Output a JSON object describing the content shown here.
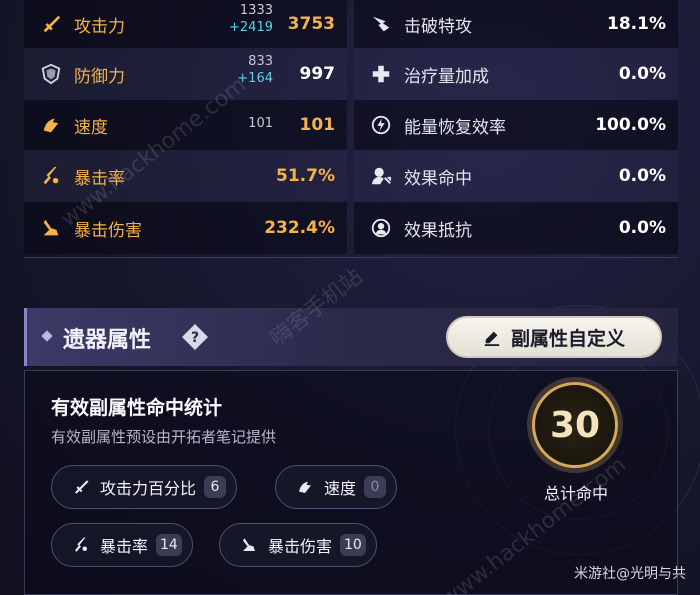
{
  "stats_left": [
    {
      "label": "攻击力",
      "icon": "attack-icon",
      "base": "1333",
      "bonus": "+2419",
      "value": "3753",
      "value_color": "gold"
    },
    {
      "label": "防御力",
      "icon": "defense-icon",
      "base": "833",
      "bonus": "+164",
      "value": "997",
      "value_color": "white"
    },
    {
      "label": "速度",
      "icon": "speed-icon",
      "base": "101",
      "bonus": "",
      "value": "101",
      "value_color": "gold"
    },
    {
      "label": "暴击率",
      "icon": "crit-rate-icon",
      "base": "",
      "bonus": "",
      "value": "51.7%",
      "value_color": "gold"
    },
    {
      "label": "暴击伤害",
      "icon": "crit-damage-icon",
      "base": "",
      "bonus": "",
      "value": "232.4%",
      "value_color": "gold"
    }
  ],
  "stats_right": [
    {
      "label": "击破特攻",
      "icon": "break-effect-icon",
      "value": "18.1%"
    },
    {
      "label": "治疗量加成",
      "icon": "healing-boost-icon",
      "value": "0.0%"
    },
    {
      "label": "能量恢复效率",
      "icon": "energy-regen-icon",
      "value": "100.0%"
    },
    {
      "label": "效果命中",
      "icon": "effect-hit-icon",
      "value": "0.0%"
    },
    {
      "label": "效果抵抗",
      "icon": "effect-res-icon",
      "value": "0.0%"
    }
  ],
  "relic": {
    "title": "遗器属性",
    "custom_button": "副属性自定义",
    "panel_title": "有效副属性命中统计",
    "panel_subtitle": "有效副属性预设由开拓者笔记提供",
    "total_value": "30",
    "total_label": "总计命中",
    "chips": [
      {
        "label": "攻击力百分比",
        "count": "6"
      },
      {
        "label": "速度",
        "count": "0"
      },
      {
        "label": "暴击率",
        "count": "14"
      },
      {
        "label": "暴击伤害",
        "count": "10"
      }
    ]
  },
  "footer": {
    "credit": "米游社@光明与共"
  },
  "watermarks": [
    "www.hackhome.com",
    "嗨客手机站",
    "www.hackhome.com"
  ],
  "colors": {
    "accent_gold": "#f3b24a",
    "bonus_cyan": "#5ad0e8",
    "ring_gold": "#d5a85a"
  }
}
